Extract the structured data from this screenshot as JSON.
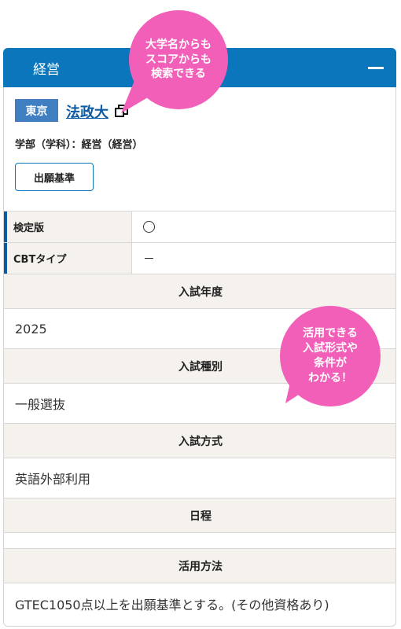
{
  "header": {
    "title": "経営"
  },
  "card": {
    "prefecture": "東京",
    "university": "法政大",
    "department": "学部（学科）：経営（経営）",
    "criteria_button": "出願基準"
  },
  "kv_rows": [
    {
      "key": "検定版",
      "value": "○"
    },
    {
      "key": "CBTタイプ",
      "value": "－"
    }
  ],
  "sections": {
    "year": {
      "label": "入試年度",
      "value": "2025"
    },
    "type": {
      "label": "入試種別",
      "value": "一般選抜"
    },
    "method": {
      "label": "入試方式",
      "value": "英語外部利用"
    },
    "schedule": {
      "label": "日程",
      "value": ""
    },
    "usage": {
      "label": "活用方法",
      "value": "GTEC1050点以上を出願基準とする。(その他資格あり)"
    }
  },
  "callouts": {
    "search": "大学名からも\nスコアからも\n検索できる",
    "conditions": "活用できる\n入試形式や\n条件が\nわかる！"
  },
  "colors": {
    "accent": "#0b76bb",
    "callout": "#f25fb8",
    "key_bg": "#f5f2ed"
  }
}
